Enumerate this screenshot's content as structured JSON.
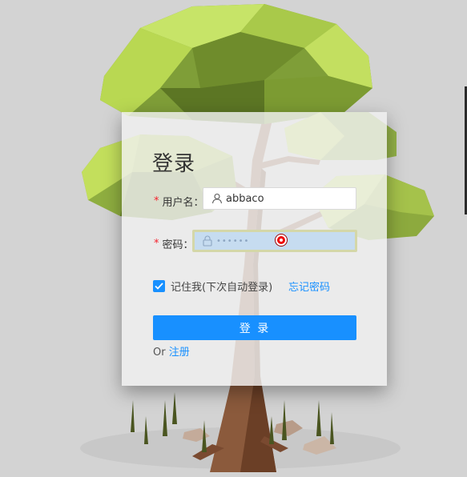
{
  "login": {
    "title": "登录",
    "username_label": "用户名",
    "username_value": "abbaco",
    "password_label": "密码",
    "password_mask": "••••••",
    "remember_label": "记住我(下次自动登录)",
    "forgot_label": "忘记密码",
    "submit_label": "登 录",
    "or_text": "Or",
    "register_label": "注册",
    "label_colon": "：",
    "required_mark": "*"
  },
  "colors": {
    "primary": "#1890ff",
    "required": "#f5222d"
  },
  "icons": {
    "username": "user-icon",
    "password": "lock-icon",
    "checkbox": "check-icon"
  }
}
